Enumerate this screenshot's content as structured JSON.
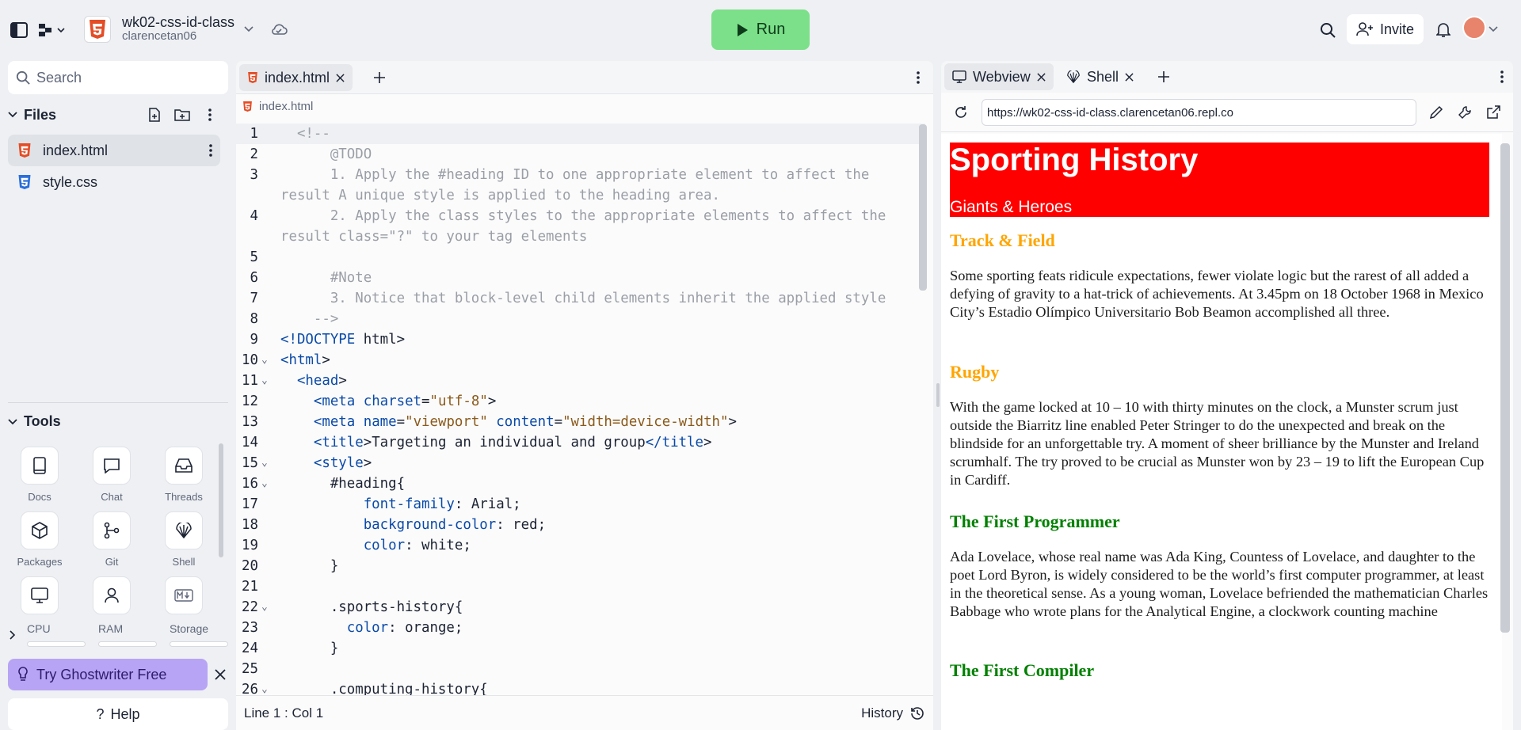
{
  "repl": {
    "title": "wk02-css-id-class",
    "owner": "clarencetan06"
  },
  "toolbar": {
    "run_label": "Run",
    "invite_label": "Invite"
  },
  "sidebar": {
    "search_placeholder": "Search",
    "files_label": "Files",
    "files": [
      {
        "name": "index.html"
      },
      {
        "name": "style.css"
      }
    ],
    "tools_label": "Tools",
    "tools": [
      {
        "label": "Docs"
      },
      {
        "label": "Chat"
      },
      {
        "label": "Threads"
      },
      {
        "label": "Packages"
      },
      {
        "label": "Git"
      },
      {
        "label": "Shell"
      }
    ],
    "resources": {
      "cpu": "CPU",
      "ram": "RAM",
      "storage": "Storage"
    },
    "ghostwriter_label": "Try Ghostwriter Free",
    "help_label": "Help"
  },
  "editor": {
    "tab_label": "index.html",
    "breadcrumb": "index.html",
    "status_position": "Line 1 : Col 1",
    "history_label": "History",
    "lines": [
      {
        "n": "1",
        "t": "  <!--"
      },
      {
        "n": "2",
        "t": "      @TODO"
      },
      {
        "n": "3",
        "t": "      1. Apply the #heading ID to one appropriate element to affect the"
      },
      {
        "n": "",
        "t": "result A unique style is applied to the heading area."
      },
      {
        "n": "4",
        "t": "      2. Apply the class styles to the appropriate elements to affect the"
      },
      {
        "n": "",
        "t": "result class=\"?\" to your tag elements"
      },
      {
        "n": "5",
        "t": ""
      },
      {
        "n": "6",
        "t": "      #Note"
      },
      {
        "n": "7",
        "t": "      3. Notice that block-level child elements inherit the applied style"
      },
      {
        "n": "8",
        "t": "    -->"
      },
      {
        "n": "9",
        "t": "<!DOCTYPE html>"
      },
      {
        "n": "10",
        "t": "<html>"
      },
      {
        "n": "11",
        "t": "  <head>"
      },
      {
        "n": "12",
        "t": "    <meta charset=\"utf-8\">"
      },
      {
        "n": "13",
        "t": "    <meta name=\"viewport\" content=\"width=device-width\">"
      },
      {
        "n": "14",
        "t": "    <title>Targeting an individual and group</title>"
      },
      {
        "n": "15",
        "t": "    <style>"
      },
      {
        "n": "16",
        "t": "      #heading{"
      },
      {
        "n": "17",
        "t": "          font-family: Arial;"
      },
      {
        "n": "18",
        "t": "          background-color: red;"
      },
      {
        "n": "19",
        "t": "          color: white;"
      },
      {
        "n": "20",
        "t": "      }"
      },
      {
        "n": "21",
        "t": ""
      },
      {
        "n": "22",
        "t": "      .sports-history{"
      },
      {
        "n": "23",
        "t": "        color: orange;"
      },
      {
        "n": "24",
        "t": "      }"
      },
      {
        "n": "25",
        "t": ""
      },
      {
        "n": "26",
        "t": "      .computing-history{"
      }
    ]
  },
  "webview": {
    "tab_webview": "Webview",
    "tab_shell": "Shell",
    "url": "https://wk02-css-id-class.clarencetan06.repl.co",
    "page": {
      "title": "Sporting History",
      "subtitle": "Giants & Heroes",
      "sections": [
        {
          "heading": "Track & Field",
          "text": "Some sporting feats ridicule expectations, fewer violate logic but the rarest of all added a defying of gravity to a hat-trick of achievements. At 3.45pm on 18 October 1968 in Mexico City’s Estadio Olímpico Universitario Bob Beamon accomplished all three."
        },
        {
          "heading": "Rugby",
          "text": "With the game locked at 10 – 10 with thirty minutes on the clock, a Munster scrum just outside the Biarritz line enabled Peter Stringer to do the unexpected and break on the blindside for an unforgettable try. A moment of sheer brilliance by the Munster and Ireland scrumhalf. The try proved to be crucial as Munster won by 23 – 19 to lift the European Cup in Cardiff."
        },
        {
          "heading": "The First Programmer",
          "text": "Ada Lovelace, whose real name was Ada King, Countess of Lovelace, and daughter to the poet Lord Byron, is widely considered to be the world’s first computer programmer, at least in the theoretical sense. As a young woman, Lovelace befriended the mathematician Charles Babbage who wrote plans for the Analytical Engine, a clockwork counting machine"
        },
        {
          "heading": "The First Compiler",
          "text": ""
        }
      ]
    }
  }
}
